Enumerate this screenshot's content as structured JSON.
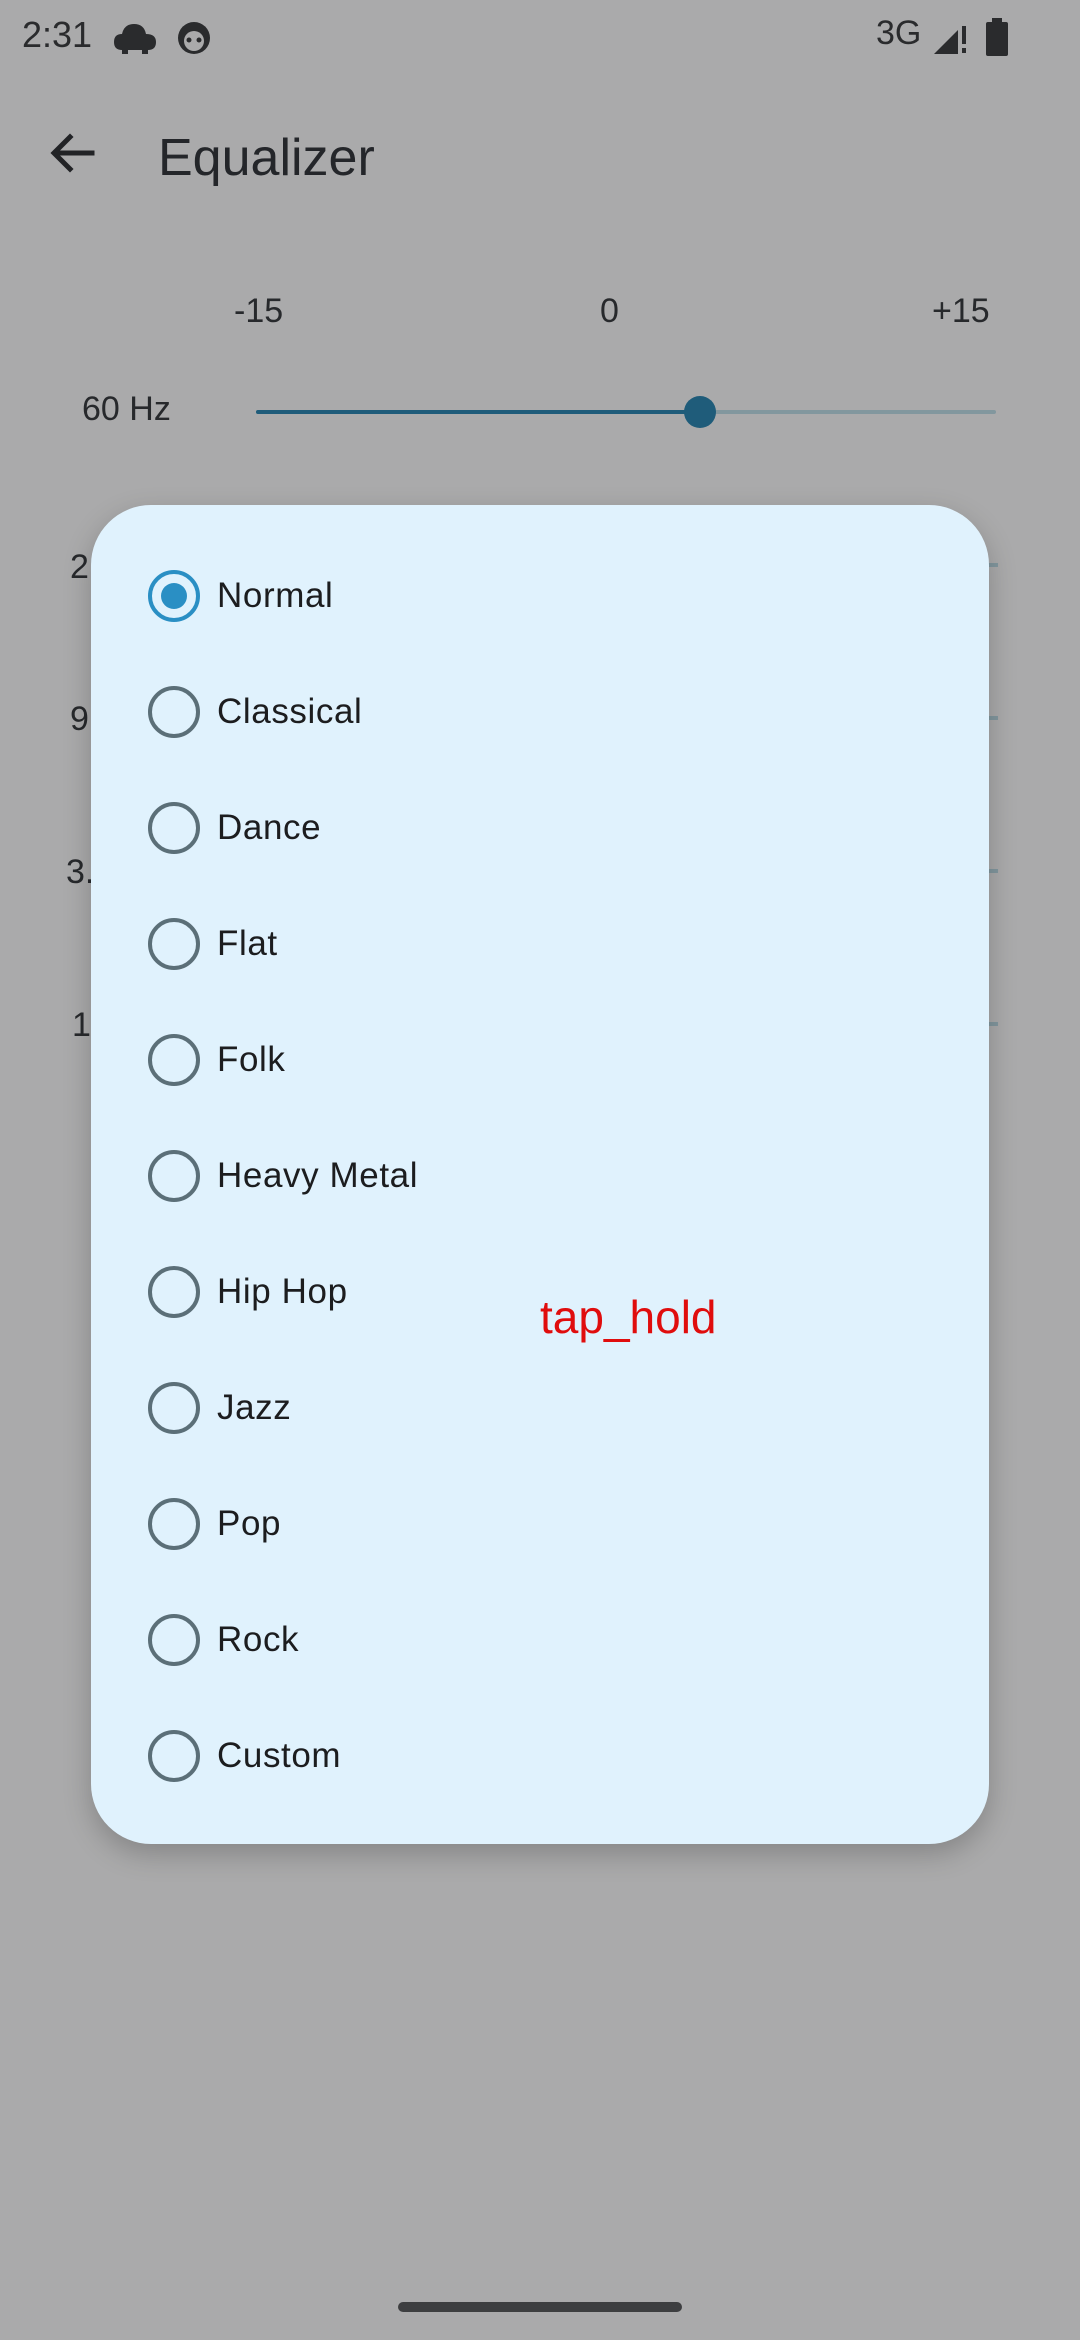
{
  "status_bar": {
    "time": "2:31",
    "network": "3G",
    "icons": [
      "cloud-icon",
      "face-icon",
      "signal-icon",
      "battery-icon"
    ]
  },
  "app_bar": {
    "title": "Equalizer",
    "back_icon": "arrow-left-icon"
  },
  "scale": {
    "min": "-15",
    "mid": "0",
    "max": "+15"
  },
  "bands": [
    {
      "label": "60 Hz",
      "value_db": 3
    }
  ],
  "partial_band_labels": [
    "2",
    "9",
    "3.",
    "1"
  ],
  "dialog": {
    "options": [
      {
        "label": "Normal",
        "selected": true
      },
      {
        "label": "Classical",
        "selected": false
      },
      {
        "label": "Dance",
        "selected": false
      },
      {
        "label": "Flat",
        "selected": false
      },
      {
        "label": "Folk",
        "selected": false
      },
      {
        "label": "Heavy Metal",
        "selected": false
      },
      {
        "label": "Hip Hop",
        "selected": false
      },
      {
        "label": "Jazz",
        "selected": false
      },
      {
        "label": "Pop",
        "selected": false
      },
      {
        "label": "Rock",
        "selected": false
      },
      {
        "label": "Custom",
        "selected": false
      }
    ]
  },
  "overlay": {
    "label": "tap_hold"
  },
  "colors": {
    "accent": "#2a8fc4",
    "slider": "#1f5c7a",
    "dialog_bg": "#e0f2fd",
    "scrim_bg": "#aaaaab",
    "overlay_text": "#e00d0d"
  }
}
